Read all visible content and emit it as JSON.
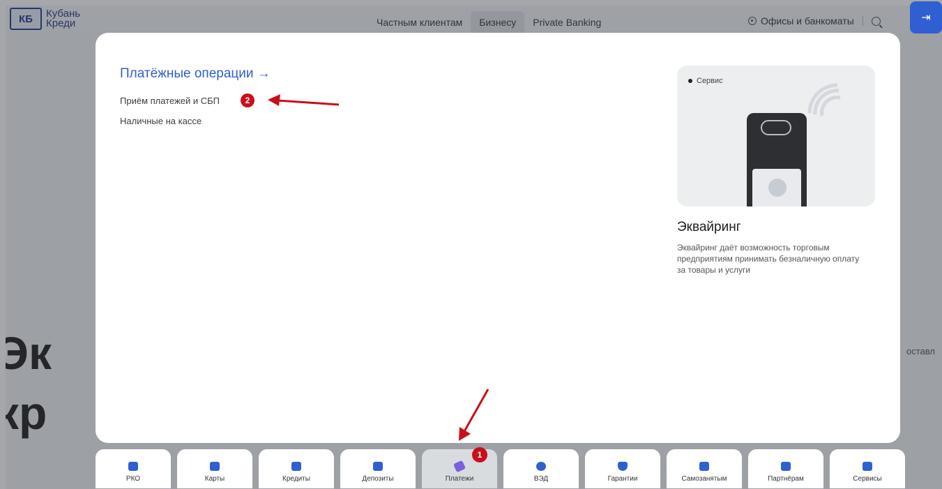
{
  "header": {
    "logo_mark": "КБ",
    "logo_line1": "Кубань",
    "logo_line2": "Креди",
    "nav": [
      "Частным клиентам",
      "Бизнесу",
      "Private Banking"
    ],
    "offices": "Офисы и банкоматы"
  },
  "background": {
    "hero_line1": "Эк",
    "hero_line2": "кр",
    "side_text": "оставл"
  },
  "menu": {
    "section_title": "Платёжные операции →",
    "links": [
      "Приём платежей и СБП",
      "Наличные на кассе"
    ]
  },
  "promo": {
    "tag": "Сервис",
    "title": "Эквайринг",
    "description": "Эквайринг даёт возможность торговым предприятиям принимать безналичную оплату за товары и услуги"
  },
  "tabs": [
    {
      "label": "РКО",
      "color": "#2f5fd0"
    },
    {
      "label": "Карты",
      "color": "#2f5fd0"
    },
    {
      "label": "Кредиты",
      "color": "#2f5fd0"
    },
    {
      "label": "Депозиты",
      "color": "#2f5fd0"
    },
    {
      "label": "Платежи",
      "color": "#7a5fe0"
    },
    {
      "label": "ВЭД",
      "color": "#2f5fd0"
    },
    {
      "label": "Гарантии",
      "color": "#2f5fd0"
    },
    {
      "label": "Самозанятым",
      "color": "#2f5fd0"
    },
    {
      "label": "Партнёрам",
      "color": "#2f5fd0"
    },
    {
      "label": "Сервисы",
      "color": "#2f5fd0"
    }
  ],
  "annotations": {
    "badge_1": "1",
    "badge_2": "2",
    "color": "#c8101a"
  }
}
